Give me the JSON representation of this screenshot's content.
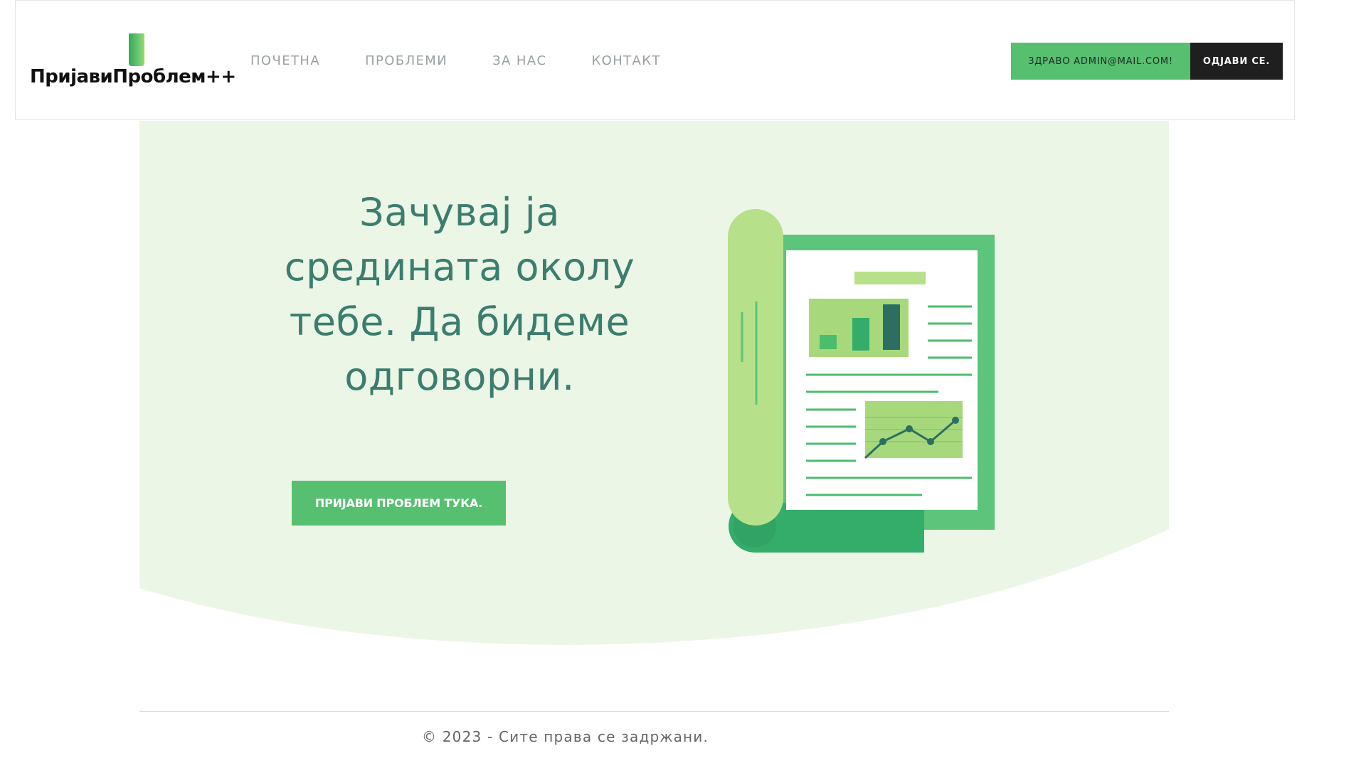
{
  "header": {
    "logo_text": "ПријавиПроблем++",
    "nav": [
      {
        "label": "ПОЧЕТНА"
      },
      {
        "label": "ПРОБЛЕМИ"
      },
      {
        "label": "ЗА НАС"
      },
      {
        "label": "КОНТАКТ"
      }
    ],
    "greeting": "ЗДРАВО ADMIN@MAIL.COM!",
    "logout_label": "ОДЈАВИ СЕ."
  },
  "hero": {
    "title": "Зачувај ја средината околу тебе. Да бидеме одговорни.",
    "cta_label": "ПРИЈАВИ ПРОБЛЕМ ТУКА."
  },
  "footer": {
    "copyright": "© 2023 - Сите права се задржани."
  },
  "colors": {
    "brand_green": "#56bf70",
    "hero_bg": "#ecf6e6",
    "title_text": "#3b7d6e",
    "dark_button": "#1f1f1f"
  }
}
